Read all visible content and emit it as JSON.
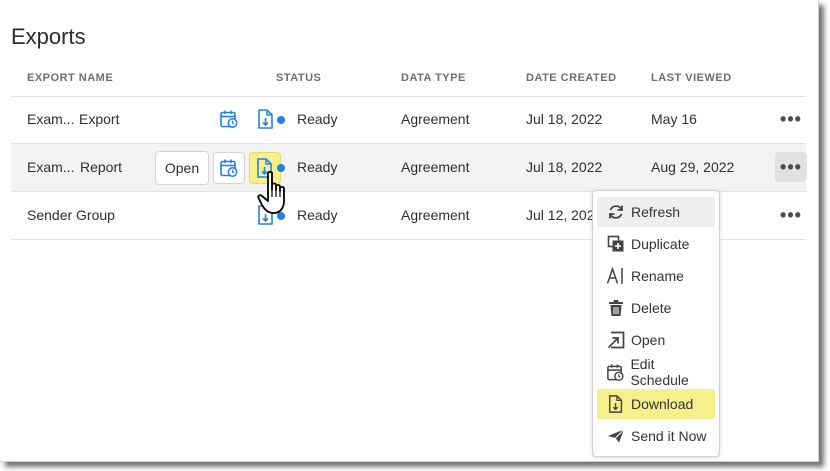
{
  "page": {
    "title": "Exports"
  },
  "table": {
    "columns": [
      "EXPORT NAME",
      "STATUS",
      "DATA TYPE",
      "DATE CREATED",
      "LAST VIEWED"
    ],
    "rows": [
      {
        "name_a": "Exam...",
        "name_b": "Export",
        "status": "Ready",
        "data_type": "Agreement",
        "date_created": "Jul 18, 2022",
        "last_viewed": "May 16"
      },
      {
        "name_a": "Exam...",
        "name_b": "Report",
        "status": "Ready",
        "data_type": "Agreement",
        "date_created": "Jul 18, 2022",
        "last_viewed": "Aug 29, 2022",
        "open_label": "Open"
      },
      {
        "name_a": "Sender Group",
        "name_b": "",
        "status": "Ready",
        "data_type": "Agreement",
        "date_created": "Jul 12, 2022",
        "last_viewed": ""
      }
    ],
    "more_label": "•••"
  },
  "menu": {
    "items": [
      {
        "label": "Refresh",
        "icon": "refresh-icon"
      },
      {
        "label": "Duplicate",
        "icon": "duplicate-icon"
      },
      {
        "label": "Rename",
        "icon": "rename-icon"
      },
      {
        "label": "Delete",
        "icon": "trash-icon"
      },
      {
        "label": "Open",
        "icon": "open-icon"
      },
      {
        "label": "Edit Schedule",
        "icon": "calendar-clock-icon"
      },
      {
        "label": "Download",
        "icon": "download-icon"
      },
      {
        "label": "Send it Now",
        "icon": "send-icon"
      }
    ]
  },
  "colors": {
    "accent": "#2680eb",
    "highlight": "#f6f08a",
    "row_hover": "#f3f3f3",
    "text": "#2c2c2c"
  }
}
